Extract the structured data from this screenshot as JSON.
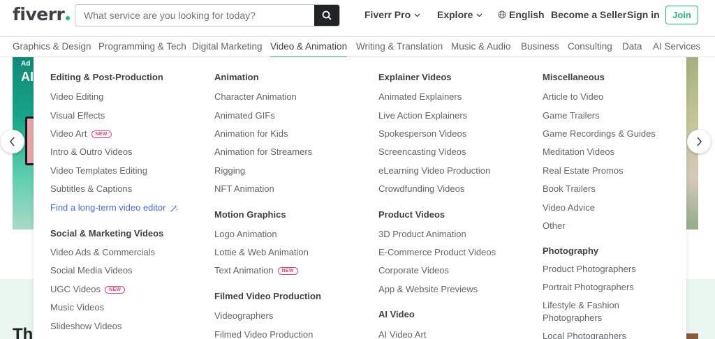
{
  "header": {
    "logo": "fiverr",
    "search_placeholder": "What service are you looking for today?",
    "nav": [
      "Fiverr Pro",
      "Explore",
      "English",
      "Become a Seller",
      "Sign in"
    ],
    "join": "Join"
  },
  "categories": [
    "Graphics & Design",
    "Programming & Tech",
    "Digital Marketing",
    "Video & Animation",
    "Writing & Translation",
    "Music & Audio",
    "Business",
    "Consulting",
    "Data",
    "AI Services"
  ],
  "background": {
    "banner_small": "Ad",
    "banner_large": "AI",
    "section_title": "Th"
  },
  "dropdown": {
    "col1": {
      "h1": "Editing & Post-Production",
      "items1": [
        "Video Editing",
        "Visual Effects",
        "Video Art",
        "Intro & Outro Videos",
        "Video Templates Editing",
        "Subtitles & Captions"
      ],
      "promo": "Find a long-term video editor",
      "h2": "Social & Marketing Videos",
      "items2": [
        "Video Ads & Commercials",
        "Social Media Videos",
        "UGC Videos",
        "Music Videos",
        "Slideshow Videos"
      ]
    },
    "col2": {
      "h1": "Animation",
      "items1": [
        "Character Animation",
        "Animated GIFs",
        "Animation for Kids",
        "Animation for Streamers",
        "Rigging",
        "NFT Animation"
      ],
      "h2": "Motion Graphics",
      "items2": [
        "Logo Animation",
        "Lottie & Web Animation",
        "Text Animation"
      ],
      "h3": "Filmed Video Production",
      "items3": [
        "Videographers",
        "Filmed Video Production"
      ]
    },
    "col3": {
      "h1": "Explainer Videos",
      "items1": [
        "Animated Explainers",
        "Live Action Explainers",
        "Spokesperson Videos",
        "Screencasting Videos",
        "eLearning Video Production",
        "Crowdfunding Videos"
      ],
      "h2": "Product Videos",
      "items2": [
        "3D Product Animation",
        "E-Commerce Product Videos",
        "Corporate Videos",
        "App & Website Previews"
      ],
      "h3": "AI Video",
      "items3": [
        "AI Video Art"
      ]
    },
    "col4": {
      "h1": "Miscellaneous",
      "items1": [
        "Article to Video",
        "Game Trailers",
        "Game Recordings & Guides",
        "Meditation Videos",
        "Real Estate Promos",
        "Book Trailers",
        "Video Advice",
        "Other"
      ],
      "h2": "Photography",
      "items2": [
        "Product Photographers",
        "Portrait Photographers",
        "Lifestyle & Fashion",
        "Photographers",
        "Local Photographers"
      ]
    },
    "badge": "NEW"
  }
}
